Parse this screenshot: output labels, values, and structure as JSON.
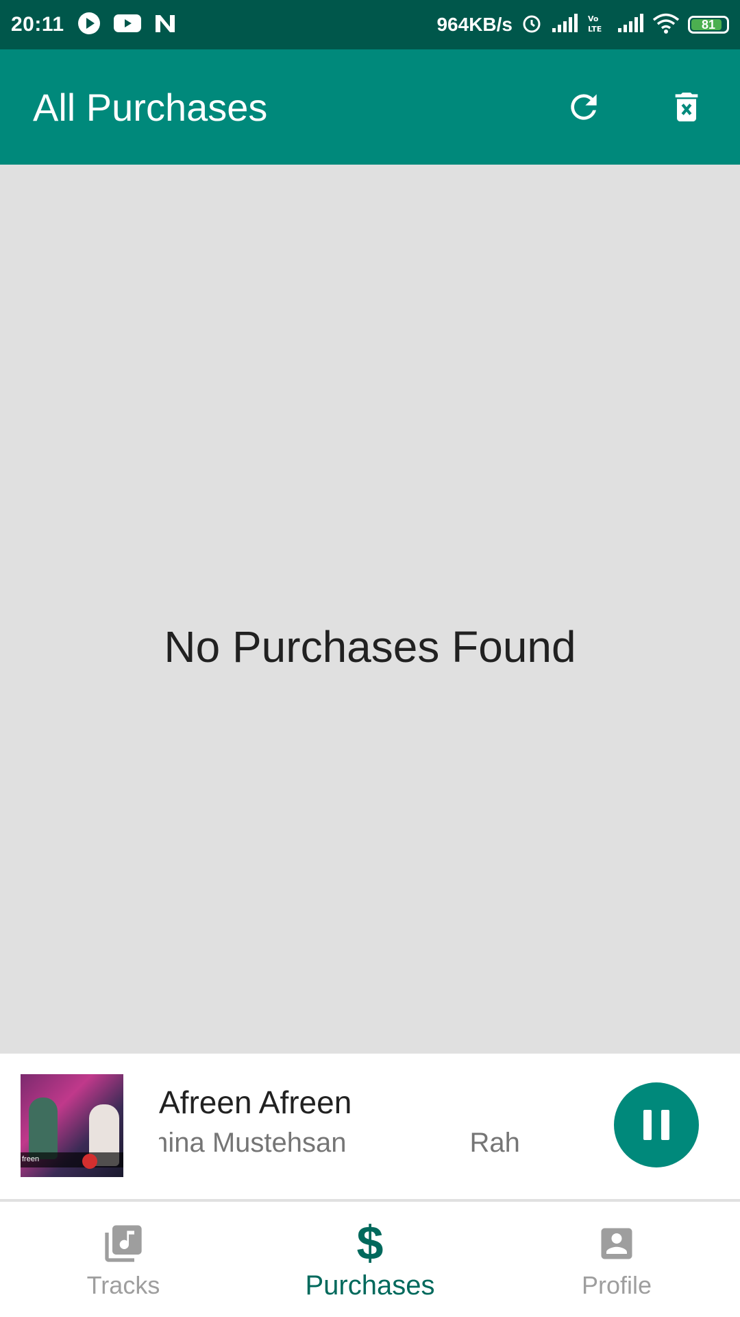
{
  "status_bar": {
    "time": "20:11",
    "speed": "964KB/s",
    "battery": "81",
    "icons": [
      "play-icon",
      "youtube-icon",
      "n-app-icon",
      "alarm-icon",
      "signal-icon",
      "volte-icon",
      "signal-icon",
      "wifi-icon",
      "battery-icon"
    ]
  },
  "app_bar": {
    "title": "All Purchases",
    "actions": [
      "refresh-icon",
      "delete-icon"
    ]
  },
  "main": {
    "empty_message": "No Purchases Found"
  },
  "player": {
    "title": "Afreen Afreen",
    "artist_visible": "mina Mustehsan",
    "artist_marquee_next": "Rah",
    "art_caption": "freen",
    "control": "pause-icon"
  },
  "bottom_nav": {
    "items": [
      {
        "label": "Tracks",
        "icon": "music-library-icon",
        "active": false
      },
      {
        "label": "Purchases",
        "icon": "dollar-icon",
        "active": true
      },
      {
        "label": "Profile",
        "icon": "profile-icon",
        "active": false
      }
    ]
  },
  "colors": {
    "status_bar": "#00574b",
    "primary": "#00897b",
    "active_nav": "#00695c",
    "background": "#e0e0e0"
  }
}
